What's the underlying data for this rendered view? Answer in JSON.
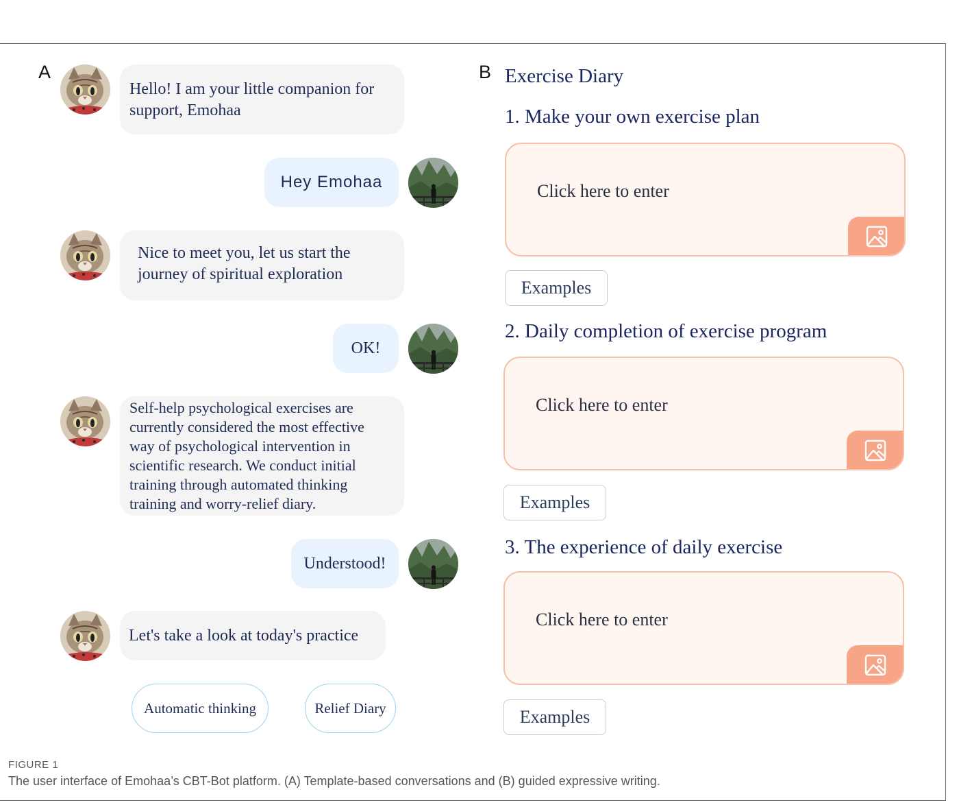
{
  "panels": {
    "a": "A",
    "b": "B"
  },
  "chat": {
    "messages": [
      {
        "from": "bot",
        "text": "Hello! I am your little companion for support, Emohaa"
      },
      {
        "from": "user",
        "text": "Hey Emohaa"
      },
      {
        "from": "bot",
        "text": "Nice to meet you, let us start the journey of spiritual exploration"
      },
      {
        "from": "user",
        "text": "OK!"
      },
      {
        "from": "bot",
        "text": "Self-help psychological exercises are currently considered the most effective way of psychological intervention in scientific research. We conduct initial training through automated thinking training and worry-relief diary."
      },
      {
        "from": "user",
        "text": "Understood!"
      },
      {
        "from": "bot",
        "text": "Let's take a look at today's practice"
      }
    ],
    "quick_replies": [
      "Automatic thinking",
      "Relief Diary"
    ]
  },
  "diary": {
    "title": "Exercise Diary",
    "sections": [
      {
        "title": "1. Make your own exercise plan",
        "placeholder": "Click here to enter",
        "examples_label": "Examples"
      },
      {
        "title": "2. Daily completion of exercise program",
        "placeholder": "Click here to enter",
        "examples_label": "Examples"
      },
      {
        "title": "3. The experience of daily exercise",
        "placeholder": "Click here to enter",
        "examples_label": "Examples"
      }
    ],
    "image_icon": "image-upload-icon",
    "accent_color": "#f7a487"
  },
  "caption": {
    "label": "FIGURE 1",
    "text": "The user interface of Emohaa’s CBT-Bot platform. (A) Template-based conversations and (B) guided expressive writing."
  }
}
